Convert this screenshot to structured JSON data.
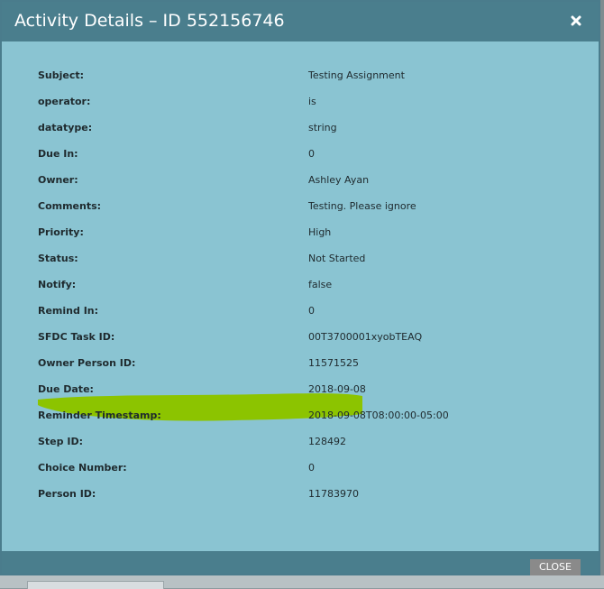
{
  "dialog": {
    "title": "Activity Details – ID 552156746",
    "close_icon": "close-icon",
    "close_button_label": "CLOSE"
  },
  "fields": [
    {
      "label": "Subject:",
      "value": "Testing Assignment"
    },
    {
      "label": "operator:",
      "value": "is"
    },
    {
      "label": "datatype:",
      "value": "string"
    },
    {
      "label": "Due In:",
      "value": "0"
    },
    {
      "label": "Owner:",
      "value": "Ashley Ayan"
    },
    {
      "label": "Comments:",
      "value": "Testing. Please ignore"
    },
    {
      "label": "Priority:",
      "value": "High"
    },
    {
      "label": "Status:",
      "value": "Not Started"
    },
    {
      "label": "Notify:",
      "value": "false"
    },
    {
      "label": "Remind In:",
      "value": "0"
    },
    {
      "label": "SFDC Task ID:",
      "value": "00T3700001xyobTEAQ"
    },
    {
      "label": "Owner Person ID:",
      "value": "11571525"
    },
    {
      "label": "Due Date:",
      "value": "2018-09-08"
    },
    {
      "label": "Reminder Timestamp:",
      "value": "2018-09-08T08:00:00-05:00"
    },
    {
      "label": "Step ID:",
      "value": "128492"
    },
    {
      "label": "Choice Number:",
      "value": "0"
    },
    {
      "label": "Person ID:",
      "value": "11783970"
    }
  ],
  "colors": {
    "titlebar": "#4a7e8d",
    "body": "#8ac4d2",
    "highlight": "#8cc400",
    "close_button": "#8a8a8a"
  }
}
